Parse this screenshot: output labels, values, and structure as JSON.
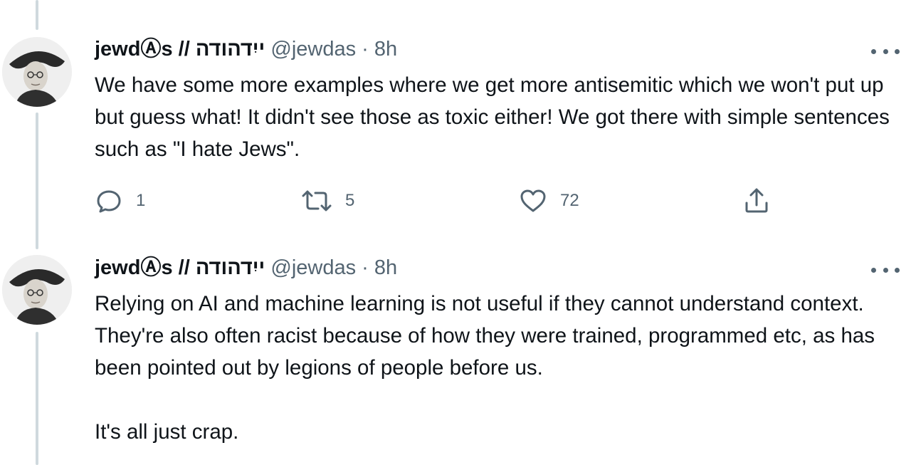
{
  "tweets": [
    {
      "author": {
        "display_name": "jewdⒶs // ייִדהודה",
        "handle": "@jewdas"
      },
      "separator": "·",
      "timestamp": "8h",
      "text": "We have some more examples where we get more antisemitic which we won't put up but guess what! It didn't see those as toxic either! We got there with simple sentences such as \"I hate Jews\".",
      "actions": {
        "reply_count": "1",
        "retweet_count": "5",
        "like_count": "72"
      }
    },
    {
      "author": {
        "display_name": "jewdⒶs // ייִדהודה",
        "handle": "@jewdas"
      },
      "separator": "·",
      "timestamp": "8h",
      "text": "Relying on AI and machine learning is not useful if they cannot understand context. They're also often racist because of how they were trained, programmed etc, as has been pointed out by legions of people before us.\n\nIt's all just crap."
    }
  ],
  "icons": {
    "reply": "comment-bubble-icon",
    "retweet": "retweet-arrows-icon",
    "like": "heart-icon",
    "share": "share-upload-icon",
    "more": "more-dots-icon"
  },
  "colors": {
    "text_primary": "#0f1419",
    "text_secondary": "#536471",
    "thread_line": "#cfd9de",
    "background": "#ffffff"
  }
}
